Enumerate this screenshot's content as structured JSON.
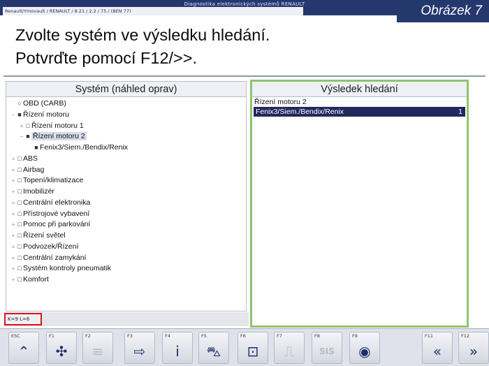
{
  "window": {
    "title": "Diagnostika elektronických systémů RENAULT",
    "path": "Renault/Ymovault / RENAULT / 8.21 / 2.2 / 75 / (BEN 77)"
  },
  "figure_label": "Obrázek 7",
  "instruction": {
    "line1": "Zvolte systém ve výsledku hledání.",
    "line2": "Potvrďte pomocí F12/>>."
  },
  "left_panel": {
    "header": "Systém (náhled oprav)",
    "items": [
      {
        "label": "OBD (CARB)",
        "marker": "○",
        "expander": "",
        "level": 0,
        "selected": false
      },
      {
        "label": "Řízení motoru",
        "marker": "■",
        "expander": "−",
        "level": 0,
        "selected": false
      },
      {
        "label": "Řízení motoru 1",
        "marker": "□",
        "expander": "+",
        "level": 1,
        "selected": false
      },
      {
        "label": "Řízení motoru 2",
        "marker": "■",
        "expander": "−",
        "level": 1,
        "selected": true
      },
      {
        "label": "Fenix3/Siem./Bendix/Renix",
        "marker": "■",
        "expander": "",
        "level": 2,
        "selected": false
      },
      {
        "label": "ABS",
        "marker": "□",
        "expander": "+",
        "level": 0,
        "selected": false
      },
      {
        "label": "Airbag",
        "marker": "□",
        "expander": "+",
        "level": 0,
        "selected": false
      },
      {
        "label": "Topení/klimatizace",
        "marker": "□",
        "expander": "+",
        "level": 0,
        "selected": false
      },
      {
        "label": "Imobilizér",
        "marker": "□",
        "expander": "+",
        "level": 0,
        "selected": false
      },
      {
        "label": "Centrální elektronika",
        "marker": "□",
        "expander": "+",
        "level": 0,
        "selected": false
      },
      {
        "label": "Přístrojové vybavení",
        "marker": "□",
        "expander": "+",
        "level": 0,
        "selected": false
      },
      {
        "label": "Pomoc při parkování",
        "marker": "□",
        "expander": "+",
        "level": 0,
        "selected": false
      },
      {
        "label": "Řízení světel",
        "marker": "□",
        "expander": "+",
        "level": 0,
        "selected": false
      },
      {
        "label": "Podvozek/Řízení",
        "marker": "□",
        "expander": "+",
        "level": 0,
        "selected": false
      },
      {
        "label": "Centrální zamykání",
        "marker": "□",
        "expander": "+",
        "level": 0,
        "selected": false
      },
      {
        "label": "Systém kontroly pneumatik",
        "marker": "□",
        "expander": "+",
        "level": 0,
        "selected": false
      },
      {
        "label": "Komfort",
        "marker": "□",
        "expander": "+",
        "level": 0,
        "selected": false
      }
    ]
  },
  "right_panel": {
    "header": "Výsledek hledání",
    "rows": [
      {
        "label": "Řízení motoru 2",
        "count": "",
        "highlight": false
      },
      {
        "label": "Fenix3/Siem./Bendix/Renix",
        "count": "1",
        "highlight": true
      }
    ]
  },
  "status": {
    "text": "K=9 L=6"
  },
  "toolbar": {
    "keys": [
      {
        "label": "ESC",
        "icon": "double-chevron-up-icon",
        "glyph": "⌃",
        "disabled": false
      },
      {
        "label": "F1",
        "icon": "puzzle-icon",
        "glyph": "✣",
        "disabled": false
      },
      {
        "label": "F2",
        "icon": "list-icon",
        "glyph": "≡",
        "disabled": true
      },
      {
        "label": "F3",
        "icon": "enter-arrow-icon",
        "glyph": "⇨",
        "disabled": false
      },
      {
        "label": "F4",
        "icon": "info-icon",
        "glyph": "i",
        "disabled": false
      },
      {
        "label": "F5",
        "icon": "car-icon",
        "glyph": "⛍",
        "disabled": false
      },
      {
        "label": "F6",
        "icon": "diagram-icon",
        "glyph": "⊡",
        "disabled": false
      },
      {
        "label": "F7",
        "icon": "wiring-icon",
        "glyph": "⎍",
        "disabled": true
      },
      {
        "label": "F8",
        "icon": "sis-icon",
        "glyph": "SIS",
        "disabled": true
      },
      {
        "label": "F9",
        "icon": "eye-icon",
        "glyph": "◉",
        "disabled": false
      },
      {
        "label": "F11",
        "icon": "back-icon",
        "glyph": "«",
        "disabled": false
      },
      {
        "label": "F12",
        "icon": "forward-icon",
        "glyph": "»",
        "disabled": false
      }
    ]
  },
  "colors": {
    "titlebar": "#25386e",
    "selection": "#22285e",
    "result_border": "#8fc46b",
    "status_border": "#e0101a"
  }
}
